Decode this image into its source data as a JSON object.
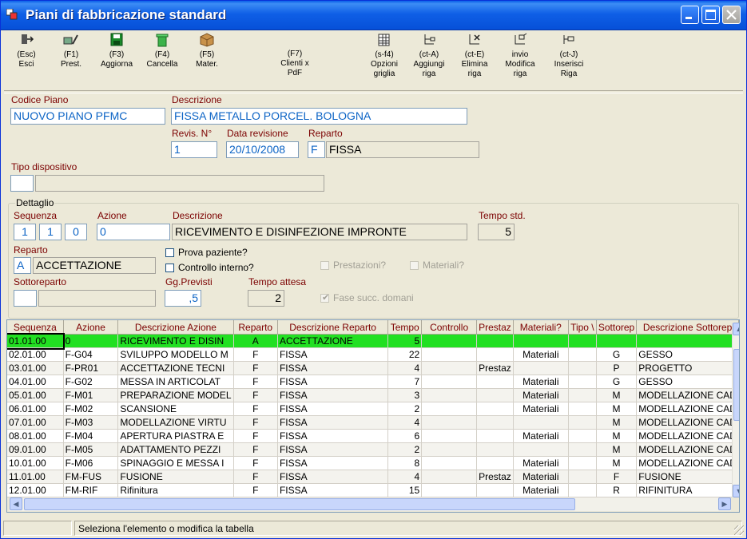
{
  "window": {
    "title": "Piani di fabbricazione standard",
    "colors": {
      "titlebar": "#0a5ee8",
      "label": "#7b0000",
      "value_text": "#0b63c5",
      "selected_row": "#22e022"
    }
  },
  "toolbar": {
    "esc": {
      "key": "(Esc)",
      "label": "Esci",
      "icon": "exit-icon"
    },
    "f1": {
      "key": "(F1)",
      "label": "Prest.",
      "icon": "edit-services-icon"
    },
    "f3": {
      "key": "(F3)",
      "label": "Aggiorna",
      "icon": "save-disk-icon"
    },
    "f4": {
      "key": "(F4)",
      "label": "Cancella",
      "icon": "trash-icon"
    },
    "f5": {
      "key": "(F5)",
      "label": "Mater.",
      "icon": "package-icon"
    },
    "f7": {
      "key": "(F7)",
      "label": "Clienti x\nPdF"
    },
    "sf4": {
      "key": "(s-f4)",
      "label": "Opzioni\ngriglia",
      "icon": "grid-options-icon"
    },
    "cta": {
      "key": "(ct-A)",
      "label": "Aggiungi\nriga",
      "icon": "add-row-icon"
    },
    "cte": {
      "key": "(ct-E)",
      "label": "Elimina\nriga",
      "icon": "delete-row-icon"
    },
    "invio": {
      "key": "invio",
      "label": "Modifica\nriga",
      "icon": "edit-row-icon"
    },
    "ctj": {
      "key": "(ct-J)",
      "label": "Inserisci\nRiga",
      "icon": "insert-row-icon"
    }
  },
  "header": {
    "codice_piano_label": "Codice Piano",
    "codice_piano": "NUOVO PIANO PFMC",
    "descrizione_label": "Descrizione",
    "descrizione": "FISSA  METALLO PORCEL. BOLOGNA",
    "revis_label": "Revis. N°",
    "revis": "1",
    "data_rev_label": "Data revisione",
    "data_rev": "20/10/2008",
    "reparto_label": "Reparto",
    "reparto_code": "F",
    "reparto_desc": "FISSA",
    "tipo_disp_label": "Tipo dispositivo",
    "tipo_disp_code": "",
    "tipo_disp_desc": ""
  },
  "dettaglio": {
    "title": "Dettaglio",
    "sequenza_label": "Sequenza",
    "seq1": "1",
    "seq2": "1",
    "seq3": "0",
    "azione_label": "Azione",
    "azione": "0",
    "descrizione_label": "Descrizione",
    "descrizione": "RICEVIMENTO E DISINFEZIONE IMPRONTE",
    "tempo_label": "Tempo std.",
    "tempo": "5",
    "reparto_label": "Reparto",
    "reparto_code": "A",
    "reparto_desc": "ACCETTAZIONE",
    "prova_paziente": "Prova paziente?",
    "controllo_interno": "Controllo interno?",
    "prestazioni": "Prestazioni?",
    "materiali": "Materiali?",
    "sottoreparto_label": "Sottoreparto",
    "sottoreparto_code": "",
    "sottoreparto_desc": "",
    "gg_label": "Gg.Previsti",
    "gg": ",5",
    "attesa_label": "Tempo attesa",
    "attesa": "2",
    "fase_succ": "Fase succ. domani"
  },
  "grid": {
    "columns": [
      "Sequenza",
      "Azione",
      "Descrizione Azione",
      "Reparto",
      "Descrizione Reparto",
      "Tempo",
      "Controllo",
      "Prestaz",
      "Materiali?",
      "Tipo \\",
      "Sottorep",
      "Descrizione Sottorep"
    ],
    "rows": [
      [
        "01.01.00",
        "0",
        "RICEVIMENTO E DISIN",
        "A",
        "ACCETTAZIONE",
        "5",
        "",
        "",
        "",
        "",
        "",
        ""
      ],
      [
        "02.01.00",
        "F-G04",
        "SVILUPPO MODELLO M",
        "F",
        "FISSA",
        "22",
        "",
        "",
        "Materiali",
        "",
        "G",
        "GESSO"
      ],
      [
        "03.01.00",
        "F-PR01",
        "ACCETTAZIONE TECNI",
        "F",
        "FISSA",
        "4",
        "",
        "Prestaz",
        "",
        "",
        "P",
        "PROGETTO"
      ],
      [
        "04.01.00",
        "F-G02",
        "MESSA IN ARTICOLAT",
        "F",
        "FISSA",
        "7",
        "",
        "",
        "Materiali",
        "",
        "G",
        "GESSO"
      ],
      [
        "05.01.00",
        "F-M01",
        "PREPARAZIONE MODEL",
        "F",
        "FISSA",
        "3",
        "",
        "",
        "Materiali",
        "",
        "M",
        "MODELLAZIONE CAD"
      ],
      [
        "06.01.00",
        "F-M02",
        "SCANSIONE",
        "F",
        "FISSA",
        "2",
        "",
        "",
        "Materiali",
        "",
        "M",
        "MODELLAZIONE CAD"
      ],
      [
        "07.01.00",
        "F-M03",
        "MODELLAZIONE VIRTU",
        "F",
        "FISSA",
        "4",
        "",
        "",
        "",
        "",
        "M",
        "MODELLAZIONE CAD"
      ],
      [
        "08.01.00",
        "F-M04",
        "APERTURA PIASTRA E",
        "F",
        "FISSA",
        "6",
        "",
        "",
        "Materiali",
        "",
        "M",
        "MODELLAZIONE CAD"
      ],
      [
        "09.01.00",
        "F-M05",
        "ADATTAMENTO PEZZI",
        "F",
        "FISSA",
        "2",
        "",
        "",
        "",
        "",
        "M",
        "MODELLAZIONE CAD"
      ],
      [
        "10.01.00",
        "F-M06",
        "SPINAGGIO E MESSA I",
        "F",
        "FISSA",
        "8",
        "",
        "",
        "Materiali",
        "",
        "M",
        "MODELLAZIONE CAD"
      ],
      [
        "11.01.00",
        "FM-FUS",
        "FUSIONE",
        "F",
        "FISSA",
        "4",
        "",
        "Prestaz",
        "Materiali",
        "",
        "F",
        "FUSIONE"
      ],
      [
        "12.01.00",
        "FM-RIF",
        "Rifinitura",
        "F",
        "FISSA",
        "15",
        "",
        "",
        "Materiali",
        "",
        "R",
        "RIFINITURA"
      ]
    ]
  },
  "status": {
    "message": "Seleziona l'elemento o modifica la tabella"
  }
}
